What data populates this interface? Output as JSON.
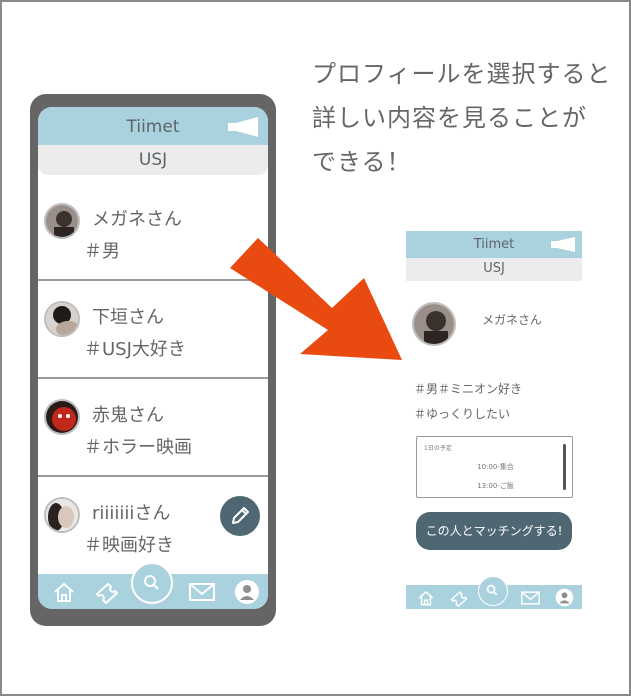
{
  "caption": [
    "プロフィールを選択すると",
    "詳しい内容を見ることが",
    "できる！"
  ],
  "app": {
    "title": "Tiimet",
    "location": "USJ"
  },
  "list": [
    {
      "name": "メガネさん",
      "tag": "＃男"
    },
    {
      "name": "下垣さん",
      "tag": "＃USJ大好き"
    },
    {
      "name": "赤鬼さん",
      "tag": "＃ホラー映画"
    },
    {
      "name": "riiiiiiiさん",
      "tag": "＃映画好き"
    }
  ],
  "detail": {
    "name": "メガネさん",
    "tags_line1": "＃男＃ミニオン好き",
    "tags_line2": "＃ゆっくりしたい",
    "schedule_title": "1日の予定",
    "schedule": [
      "10:00-集合",
      "13:00-ご飯"
    ],
    "match_button": "この人とマッチングする!"
  },
  "colors": {
    "header": "#a9d2de",
    "accent_dark": "#4f6673",
    "arrow": "#e84a10",
    "phone_frame": "#656565"
  },
  "icons": [
    "megaphone-icon",
    "edit-pencil-icon",
    "home-icon",
    "ticket-icon",
    "search-icon",
    "mail-icon",
    "user-icon"
  ]
}
